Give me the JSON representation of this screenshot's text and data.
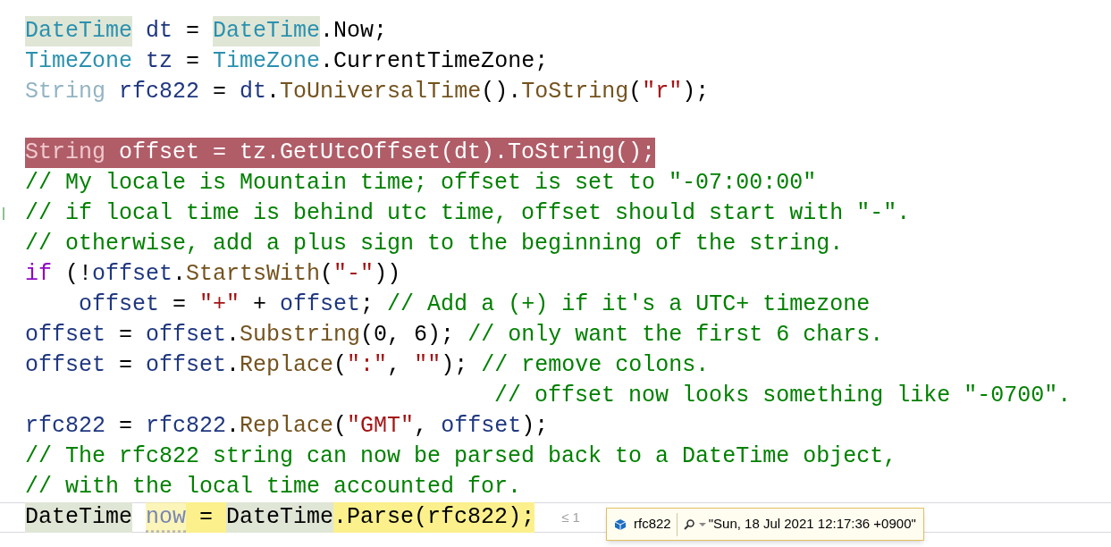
{
  "lines": [
    {
      "breakpoint": false,
      "current": false,
      "modified": false,
      "segments": [
        {
          "text": "DateTime",
          "kind": "type_referenced"
        },
        {
          "text": " dt",
          "kind": "variable"
        },
        {
          "text": " = ",
          "kind": "plain"
        },
        {
          "text": "DateTime",
          "kind": "type_referenced"
        },
        {
          "text": ".Now;",
          "kind": "plain"
        }
      ]
    },
    {
      "breakpoint": false,
      "current": false,
      "modified": false,
      "segments": [
        {
          "text": "TimeZone",
          "kind": "type"
        },
        {
          "text": " tz",
          "kind": "variable"
        },
        {
          "text": " = ",
          "kind": "plain"
        },
        {
          "text": "TimeZone",
          "kind": "type"
        },
        {
          "text": ".CurrentTimeZone;",
          "kind": "plain"
        }
      ]
    },
    {
      "breakpoint": false,
      "current": false,
      "modified": false,
      "segments": [
        {
          "text": "String",
          "kind": "faded"
        },
        {
          "text": " rfc822",
          "kind": "variable"
        },
        {
          "text": " = ",
          "kind": "plain"
        },
        {
          "text": "dt",
          "kind": "variable"
        },
        {
          "text": ".",
          "kind": "plain"
        },
        {
          "text": "ToUniversalTime",
          "kind": "method"
        },
        {
          "text": "().",
          "kind": "plain"
        },
        {
          "text": "ToString",
          "kind": "method"
        },
        {
          "text": "(",
          "kind": "plain"
        },
        {
          "text": "\"r\"",
          "kind": "string"
        },
        {
          "text": ");",
          "kind": "plain"
        }
      ]
    },
    {
      "breakpoint": false,
      "current": false,
      "modified": false
    },
    {
      "breakpoint": true,
      "current": false,
      "modified": false,
      "segments": [
        {
          "text": "String",
          "kind": "faded"
        },
        {
          "text": " offset = tz.GetUtcOffset(dt).ToString();",
          "kind": "plain"
        }
      ]
    },
    {
      "breakpoint": false,
      "current": false,
      "modified": false,
      "segments": [
        {
          "text": "// My locale is Mountain time; offset is set to \"-07:00:00\"",
          "kind": "comment"
        }
      ]
    },
    {
      "breakpoint": false,
      "current": false,
      "modified": true,
      "segments": [
        {
          "text": "// if local time is behind utc time, offset should start with \"-\".",
          "kind": "comment"
        }
      ]
    },
    {
      "breakpoint": false,
      "current": false,
      "modified": false,
      "segments": [
        {
          "text": "// otherwise, add a plus sign to the beginning of the string.",
          "kind": "comment"
        }
      ]
    },
    {
      "breakpoint": false,
      "current": false,
      "modified": false,
      "segments": [
        {
          "text": "if",
          "kind": "keyword"
        },
        {
          "text": " (!",
          "kind": "plain"
        },
        {
          "text": "offset",
          "kind": "variable"
        },
        {
          "text": ".",
          "kind": "plain"
        },
        {
          "text": "StartsWith",
          "kind": "method"
        },
        {
          "text": "(",
          "kind": "plain"
        },
        {
          "text": "\"-\"",
          "kind": "string"
        },
        {
          "text": "))",
          "kind": "plain"
        }
      ]
    },
    {
      "breakpoint": false,
      "current": false,
      "modified": false,
      "segments": [
        {
          "text": "    offset",
          "kind": "variable"
        },
        {
          "text": " = ",
          "kind": "plain"
        },
        {
          "text": "\"+\"",
          "kind": "string"
        },
        {
          "text": " + ",
          "kind": "plain"
        },
        {
          "text": "offset",
          "kind": "variable"
        },
        {
          "text": "; ",
          "kind": "plain"
        },
        {
          "text": "// Add a (+) if it's a UTC+ timezone",
          "kind": "comment"
        }
      ]
    },
    {
      "breakpoint": false,
      "current": false,
      "modified": false,
      "segments": [
        {
          "text": "offset",
          "kind": "variable"
        },
        {
          "text": " = ",
          "kind": "plain"
        },
        {
          "text": "offset",
          "kind": "variable"
        },
        {
          "text": ".",
          "kind": "plain"
        },
        {
          "text": "Substring",
          "kind": "method"
        },
        {
          "text": "(0, 6); ",
          "kind": "plain"
        },
        {
          "text": "// only want the first 6 chars.",
          "kind": "comment"
        }
      ]
    },
    {
      "breakpoint": false,
      "current": false,
      "modified": false,
      "segments": [
        {
          "text": "offset",
          "kind": "variable"
        },
        {
          "text": " = ",
          "kind": "plain"
        },
        {
          "text": "offset",
          "kind": "variable"
        },
        {
          "text": ".",
          "kind": "plain"
        },
        {
          "text": "Replace",
          "kind": "method"
        },
        {
          "text": "(",
          "kind": "plain"
        },
        {
          "text": "\":\"",
          "kind": "string"
        },
        {
          "text": ", ",
          "kind": "plain"
        },
        {
          "text": "\"\"",
          "kind": "string"
        },
        {
          "text": "); ",
          "kind": "plain"
        },
        {
          "text": "// remove colons.",
          "kind": "comment"
        }
      ]
    },
    {
      "breakpoint": false,
      "current": false,
      "modified": false,
      "segments": [
        {
          "text": "                                   // offset now looks something like \"-0700\".",
          "kind": "comment"
        }
      ]
    },
    {
      "breakpoint": false,
      "current": false,
      "modified": false,
      "segments": [
        {
          "text": "rfc822",
          "kind": "variable"
        },
        {
          "text": " = ",
          "kind": "plain"
        },
        {
          "text": "rfc822",
          "kind": "variable"
        },
        {
          "text": ".",
          "kind": "plain"
        },
        {
          "text": "Replace",
          "kind": "method"
        },
        {
          "text": "(",
          "kind": "plain"
        },
        {
          "text": "\"GMT\"",
          "kind": "string"
        },
        {
          "text": ", ",
          "kind": "plain"
        },
        {
          "text": "offset",
          "kind": "variable"
        },
        {
          "text": ");",
          "kind": "plain"
        }
      ]
    },
    {
      "breakpoint": false,
      "current": false,
      "modified": false,
      "segments": [
        {
          "text": "// The rfc822 string can now be parsed back to a DateTime object,",
          "kind": "comment"
        }
      ]
    },
    {
      "breakpoint": false,
      "current": false,
      "modified": false,
      "segments": [
        {
          "text": "// with the local time accounted for.",
          "kind": "comment"
        }
      ]
    },
    {
      "breakpoint": false,
      "current": true,
      "modified": false,
      "segments": [
        {
          "text": "DateTime",
          "kind": "type_referenced"
        },
        {
          "text": "now",
          "kind": "unused"
        },
        {
          "text": " = ",
          "kind": "plain"
        },
        {
          "text": "DateTime",
          "kind": "type_referenced"
        },
        {
          "text": ".Parse(rfc822);",
          "kind": "plain"
        }
      ]
    }
  ],
  "elapsed_hint": "≤ 1",
  "datatip": {
    "name": "rfc822",
    "value": "\"Sun, 18 Jul 2021 12:17:36 +0900\""
  }
}
